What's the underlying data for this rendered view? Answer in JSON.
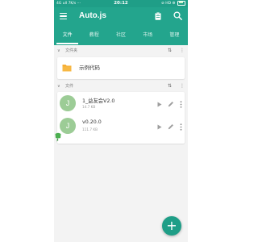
{
  "status_bar": {
    "left": "4G ull 7K/s ···",
    "time": "20:12",
    "right": "⊘ HD ⚙"
  },
  "app": {
    "title": "Auto.js",
    "colors": {
      "primary": "#23a58d",
      "primary_dark": "#1f9e87",
      "avatar": "#9ccc96",
      "folder": "#f5a623"
    }
  },
  "toolbar": {
    "menu_icon": "menu-icon",
    "clipboard_icon": "clipboard-icon",
    "search_icon": "search-icon"
  },
  "tabs": [
    {
      "label": "文件",
      "active": true
    },
    {
      "label": "教程",
      "active": false
    },
    {
      "label": "社区",
      "active": false
    },
    {
      "label": "市场",
      "active": false
    },
    {
      "label": "管理",
      "active": false
    }
  ],
  "folders_section": {
    "label": "文件夹",
    "items": [
      {
        "name": "示例代码"
      }
    ]
  },
  "files_section": {
    "label": "文件",
    "items": [
      {
        "avatar": "J",
        "name": "1_益友会V2.0",
        "size": "14.7 KB"
      },
      {
        "avatar": "J",
        "name": "v0.20.0",
        "size": "111.7 KB"
      }
    ]
  },
  "fab": {
    "label": "+"
  }
}
